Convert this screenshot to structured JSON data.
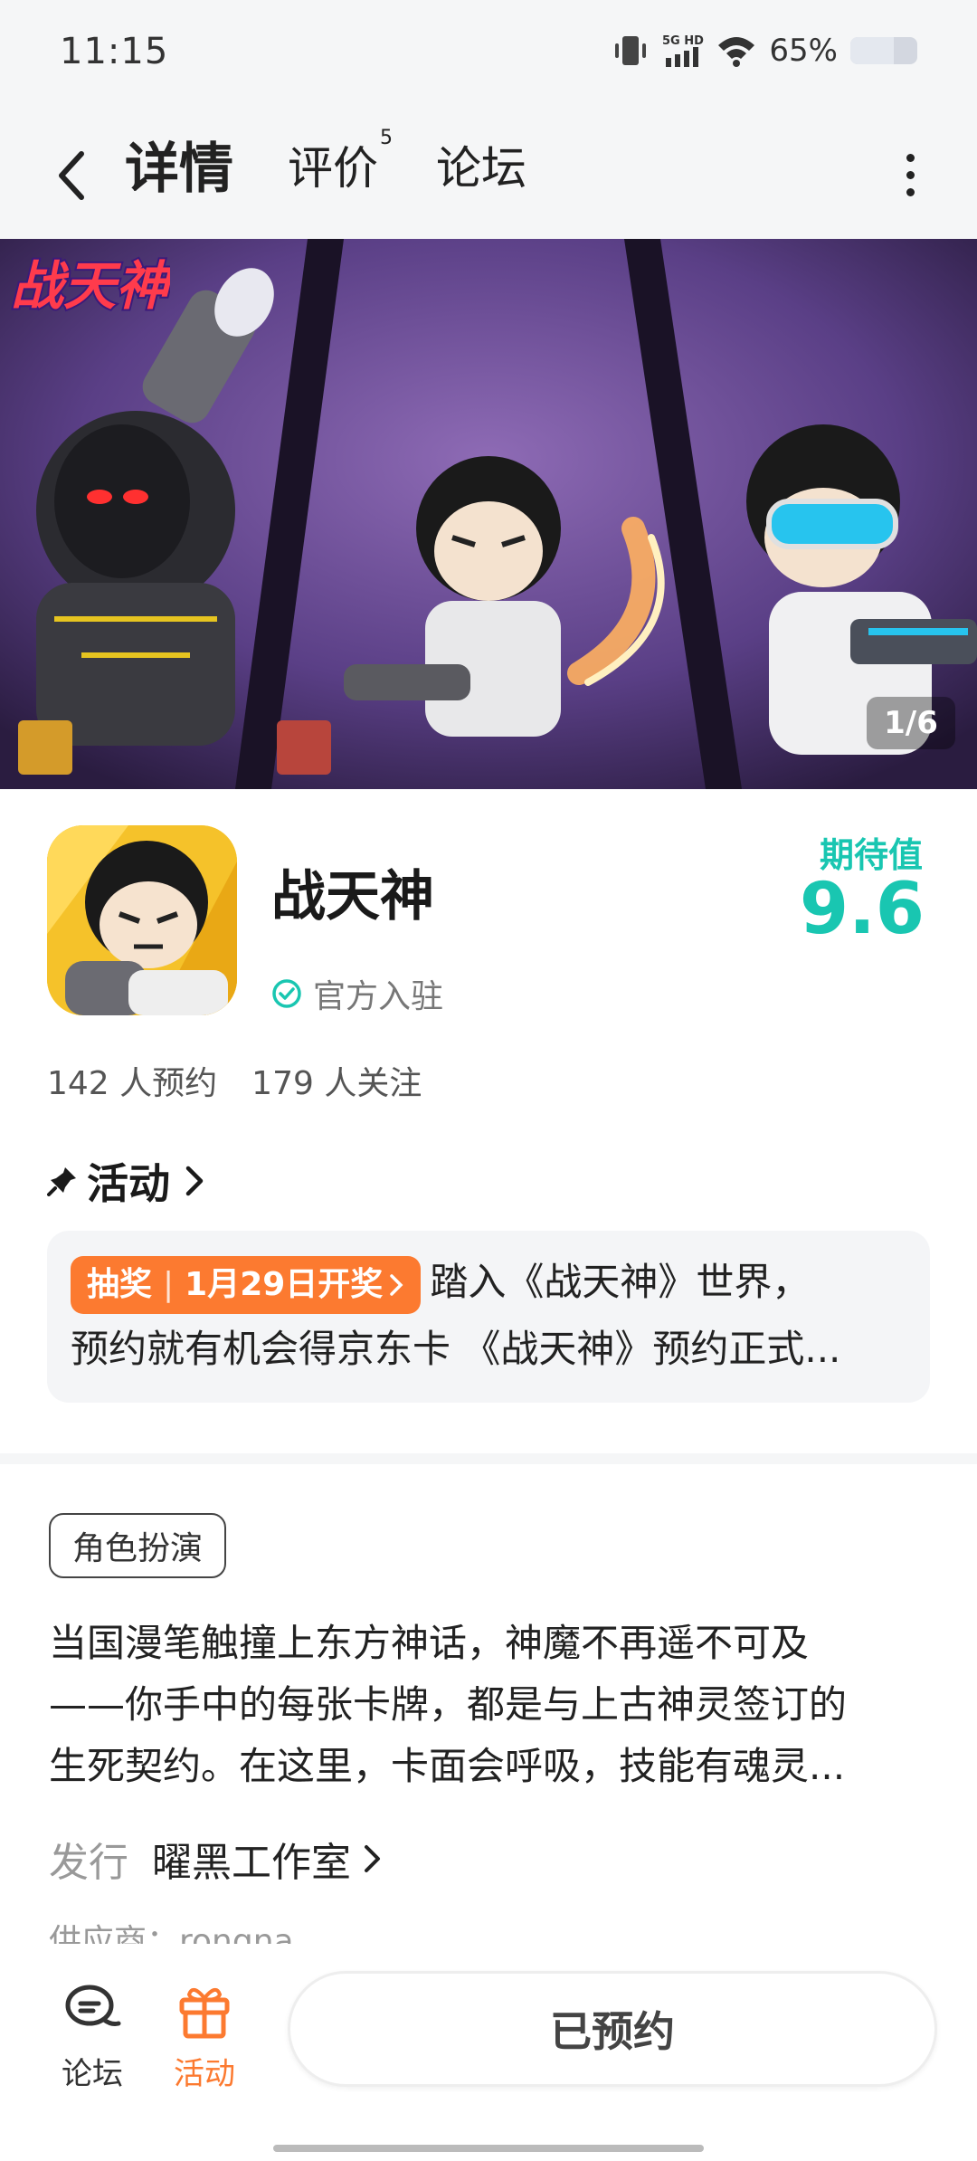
{
  "status_bar": {
    "time": "11:15",
    "net_label": "5G HD",
    "battery": "65%",
    "battery_level": 0.65
  },
  "nav": {
    "tabs": [
      {
        "label": "详情",
        "active": true
      },
      {
        "label": "评价",
        "badge": "5"
      },
      {
        "label": "论坛"
      }
    ]
  },
  "banner": {
    "logo_text": "战天神",
    "counter": "1/6"
  },
  "game": {
    "name": "战天神",
    "official_label": "官方入驻",
    "expect_label": "期待值",
    "expect_value": "9.6",
    "reservations": "142 人预约",
    "followers": "179 人关注"
  },
  "activity": {
    "title": "活动",
    "badge_type": "抽奖",
    "badge_date": "1月29日开奖",
    "line1": "踏入《战天神》世界，",
    "line2": "预约就有机会得京东卡 《战天神》预约正式..."
  },
  "details": {
    "genre": "角色扮演",
    "description": [
      "当国漫笔触撞上东方神话，神魔不再遥不可及",
      "——你手中的每张卡牌，都是与上古神灵签订的",
      "生死契约。在这里，卡面会呼吸，技能有魂灵..."
    ],
    "publisher_label": "发行",
    "publisher": "曜黑工作室",
    "supplier": "供应商：rongna"
  },
  "bottom_bar": {
    "forum_label": "论坛",
    "activity_label": "活动",
    "reserve_button": "已预约"
  },
  "colors": {
    "accent": "#19c6b1",
    "orange": "#fc7a30"
  }
}
